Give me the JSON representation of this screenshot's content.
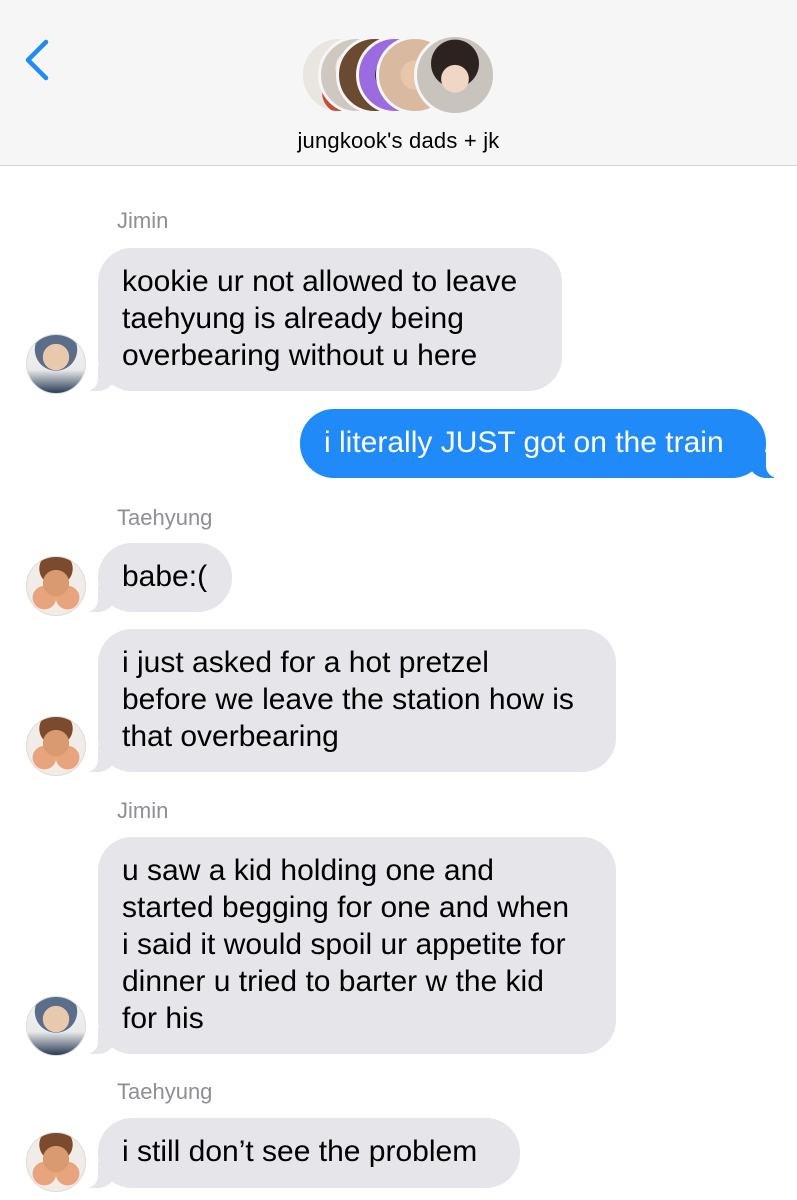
{
  "header": {
    "group_name": "jungkook's dads + jk",
    "avatar_colors": [
      "#c44b3c",
      "#e0d8d0",
      "#6b4a32",
      "#9b6be0",
      "#d9b9a0",
      "#333333"
    ]
  },
  "messages": [
    {
      "sender": "Jimin",
      "direction": "incoming",
      "text": "kookie ur not allowed to leave\ntaehyung is already being\noverbearing without u here"
    },
    {
      "sender": "",
      "direction": "outgoing",
      "text": "i literally JUST got on the train"
    },
    {
      "sender": "Taehyung",
      "direction": "incoming",
      "text": "babe:("
    },
    {
      "sender": "",
      "direction": "incoming",
      "text": "i just asked for a hot pretzel\nbefore we leave the station how is\nthat overbearing"
    },
    {
      "sender": "Jimin",
      "direction": "incoming",
      "text": "u saw a kid holding one and\nstarted begging for one and when\ni said it would spoil ur appetite for\ndinner u tried to barter w the kid\nfor his"
    },
    {
      "sender": "Taehyung",
      "direction": "incoming",
      "text": "i still don’t see the problem"
    }
  ],
  "colors": {
    "outgoing_bubble": "#1f8af8",
    "incoming_bubble": "#e5e5ea",
    "accent": "#1f8af8"
  }
}
